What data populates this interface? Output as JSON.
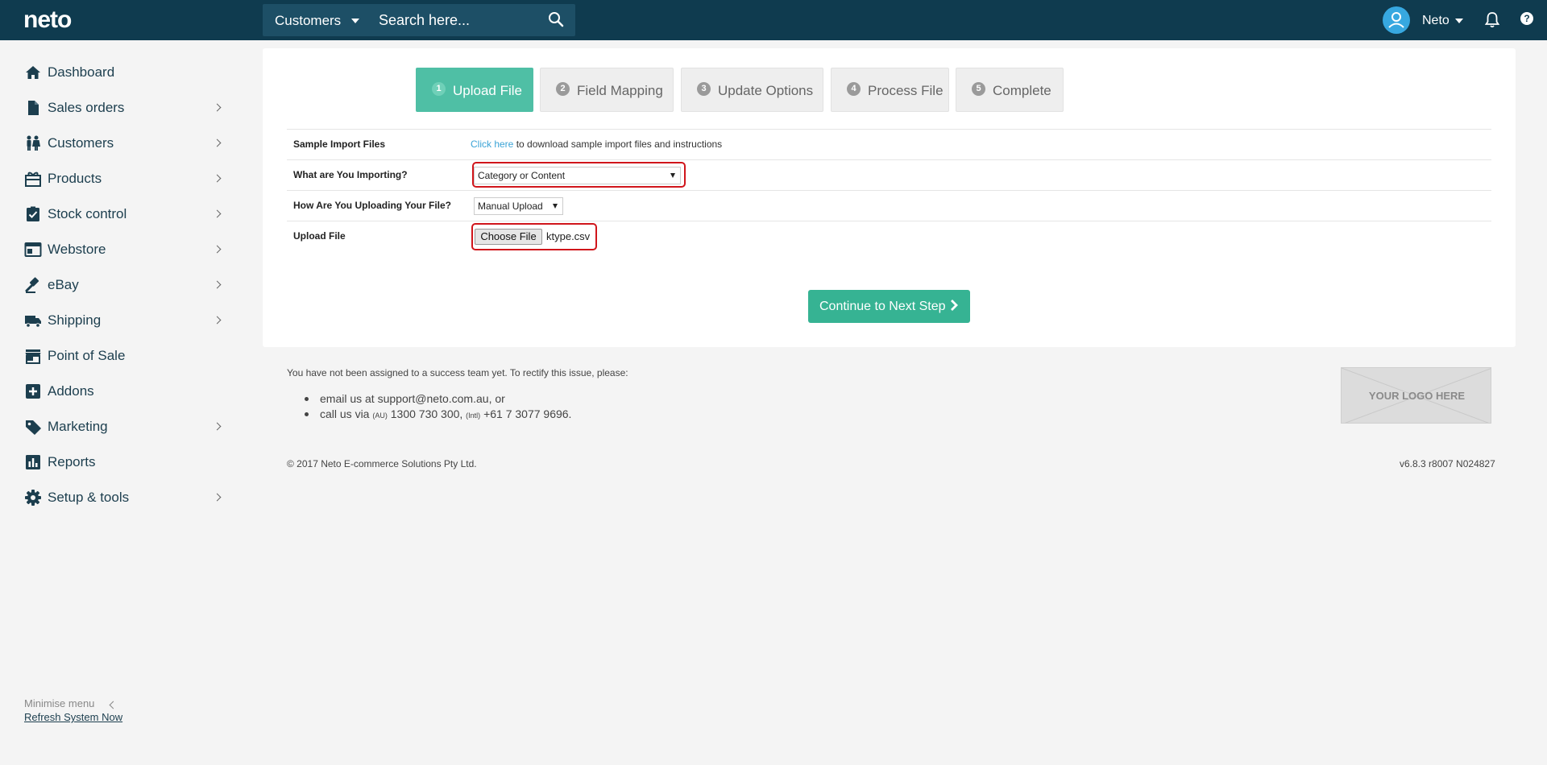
{
  "brand": {
    "logo_text": "neto"
  },
  "search": {
    "scope": "Customers",
    "placeholder": "Search here..."
  },
  "user": {
    "name": "Neto"
  },
  "help": {
    "label": "?"
  },
  "sidebar": {
    "items": [
      {
        "label": "Dashboard",
        "icon": "home-icon",
        "has_submenu": false
      },
      {
        "label": "Sales orders",
        "icon": "document-icon",
        "has_submenu": true
      },
      {
        "label": "Customers",
        "icon": "people-icon",
        "has_submenu": true
      },
      {
        "label": "Products",
        "icon": "gift-icon",
        "has_submenu": true
      },
      {
        "label": "Stock control",
        "icon": "clipboard-check-icon",
        "has_submenu": true
      },
      {
        "label": "Webstore",
        "icon": "browser-icon",
        "has_submenu": true
      },
      {
        "label": "eBay",
        "icon": "gavel-icon",
        "has_submenu": true
      },
      {
        "label": "Shipping",
        "icon": "truck-icon",
        "has_submenu": true
      },
      {
        "label": "Point of Sale",
        "icon": "store-icon",
        "has_submenu": false
      },
      {
        "label": "Addons",
        "icon": "plus-square-icon",
        "has_submenu": false
      },
      {
        "label": "Marketing",
        "icon": "tag-icon",
        "has_submenu": true
      },
      {
        "label": "Reports",
        "icon": "bar-chart-icon",
        "has_submenu": false
      },
      {
        "label": "Setup & tools",
        "icon": "gear-icon",
        "has_submenu": true
      }
    ],
    "refresh_label": "Refresh System Now",
    "minimise_label": "Minimise menu"
  },
  "wizard": {
    "steps": [
      {
        "num": "1",
        "label": "Upload File",
        "active": true
      },
      {
        "num": "2",
        "label": "Field Mapping",
        "active": false
      },
      {
        "num": "3",
        "label": "Update Options",
        "active": false
      },
      {
        "num": "4",
        "label": "Process File",
        "active": false
      },
      {
        "num": "5",
        "label": "Complete",
        "active": false
      }
    ]
  },
  "form": {
    "sample": {
      "label": "Sample Import Files",
      "link_text": "Click here",
      "rest_text": "to download sample import files and instructions"
    },
    "importing": {
      "label": "What are You Importing?",
      "value": "Category or Content"
    },
    "uploading": {
      "label": "How Are You Uploading Your File?",
      "value": "Manual Upload"
    },
    "upload": {
      "label": "Upload File",
      "button": "Choose File",
      "filename": "ktype.csv"
    },
    "continue_label": "Continue to Next Step"
  },
  "footer": {
    "note": "You have not been assigned to a success team yet. To rectify this issue, please:",
    "email_prefix": "email us at",
    "email": "support@neto.com.au",
    "email_suffix": ", or",
    "call_prefix": "call us via",
    "au_tag": "(AU)",
    "au_phone": "1300 730 300,",
    "intl_tag": "(Intl)",
    "intl_phone": "+61 7 3077 9696.",
    "logo_placeholder": "YOUR LOGO HERE",
    "copyright": "© 2017 Neto E-commerce Solutions Pty Ltd.",
    "version": "v6.8.3 r8007 N024827"
  },
  "colors": {
    "topbar": "#0f3b4f",
    "accent": "#36b393",
    "active_step": "#4fbfa5",
    "highlight": "#d0151b",
    "link": "#3aa3d6"
  }
}
